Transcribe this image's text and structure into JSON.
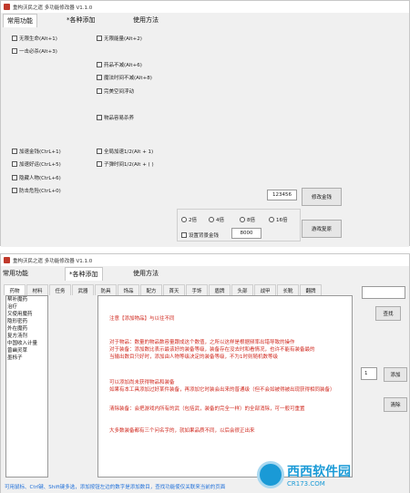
{
  "window1": {
    "title": "重构沃民之遗 多功能修改器 V1.1.0",
    "menu": [
      "常用功能",
      "*各种添加",
      "使用方法"
    ],
    "checkboxes": [
      {
        "label": "无限生命(Alt+1)"
      },
      {
        "label": "无限能量(Alt+2)"
      },
      {
        "label": "一击必杀(Alt+3)"
      },
      {
        "label": "药品不减(Alt+6)"
      },
      {
        "label": "魔法时间不减(Alt+8)"
      },
      {
        "label": "完美空间浮动"
      },
      {
        "label": "物品容易杀养"
      },
      {
        "label": "加速金钱(CtrL+1)"
      },
      {
        "label": "全局加速1/2(Alt + 1)"
      },
      {
        "label": "加速好运(CtrL+5)"
      },
      {
        "label": "子弹时间1/2(Alt + ( )"
      },
      {
        "label": "隐藏人物(CtrL+6)"
      },
      {
        "label": "防击危险(CtrL+0)"
      }
    ],
    "money_value": "123456",
    "money_button": "修改金钱",
    "radios": [
      "2倍",
      "4倍",
      "8倍",
      "16倍"
    ],
    "gameplay_checkbox": "设置背景金钱",
    "gameplay_value": "8000",
    "gameplay_button": "游戏复原"
  },
  "window2": {
    "title": "重构沃民之遗 多功能修改器 V1.1.0",
    "menu": [
      "常用功能",
      "*各种添加",
      "使用方法"
    ],
    "tabs": [
      "药物",
      "材料",
      "任务",
      "武器",
      "防具",
      "饰品",
      "配方",
      "首天",
      "手饰",
      "盾牌",
      "头部",
      "战甲",
      "长靴",
      "翻牌"
    ],
    "list_items": [
      "帮补魔药",
      "治疗",
      "又使用魔药",
      "隐形密药",
      "外在魔药",
      "复方汤剂",
      "中国收入计量",
      "曾幽灵草",
      "墨栎子"
    ],
    "search_button": "查找",
    "add_value": "1",
    "add_button": "添加",
    "clear_button": "清除",
    "info_lines": [
      "注意【添加物品】与以往不同",
      "对于物品：数量的物品数容量跟成这个数值，之所以这样是根据频率出错导致的操作",
      "对于装备：添加数比表示最该好的装备等级，装备存在没去时和看情况，也许不能有装备最的",
      "        当输出数目只好时，添加由人物等级决定的装备等级，不为1时则随机数等级",
      "可以添加尚未获得物品和装备",
      "如果有本工具添加过好某件装备，再添加它时装会出来的普通级（但不会如被得被出现获得相同装备）",
      "清除装备：会把游戏内所有的武（包括武，装备的完全一样）的全部消除，可一般可重置",
      "大多数装备都有三个问名字的，就如果品质不同，以后会很正出来"
    ],
    "status_text": "可用鼠标、Ctrl键、Shift键多选，添加按钮左边的数字是添加数目，查找功能使仅关联来当前的页面"
  },
  "watermark": {
    "main": "西西软件园",
    "sub": "CR173.COM"
  },
  "colors": {
    "info_text": "#d0281e",
    "status_text": "#1e6fd9",
    "watermark": "#1a9ad6"
  }
}
